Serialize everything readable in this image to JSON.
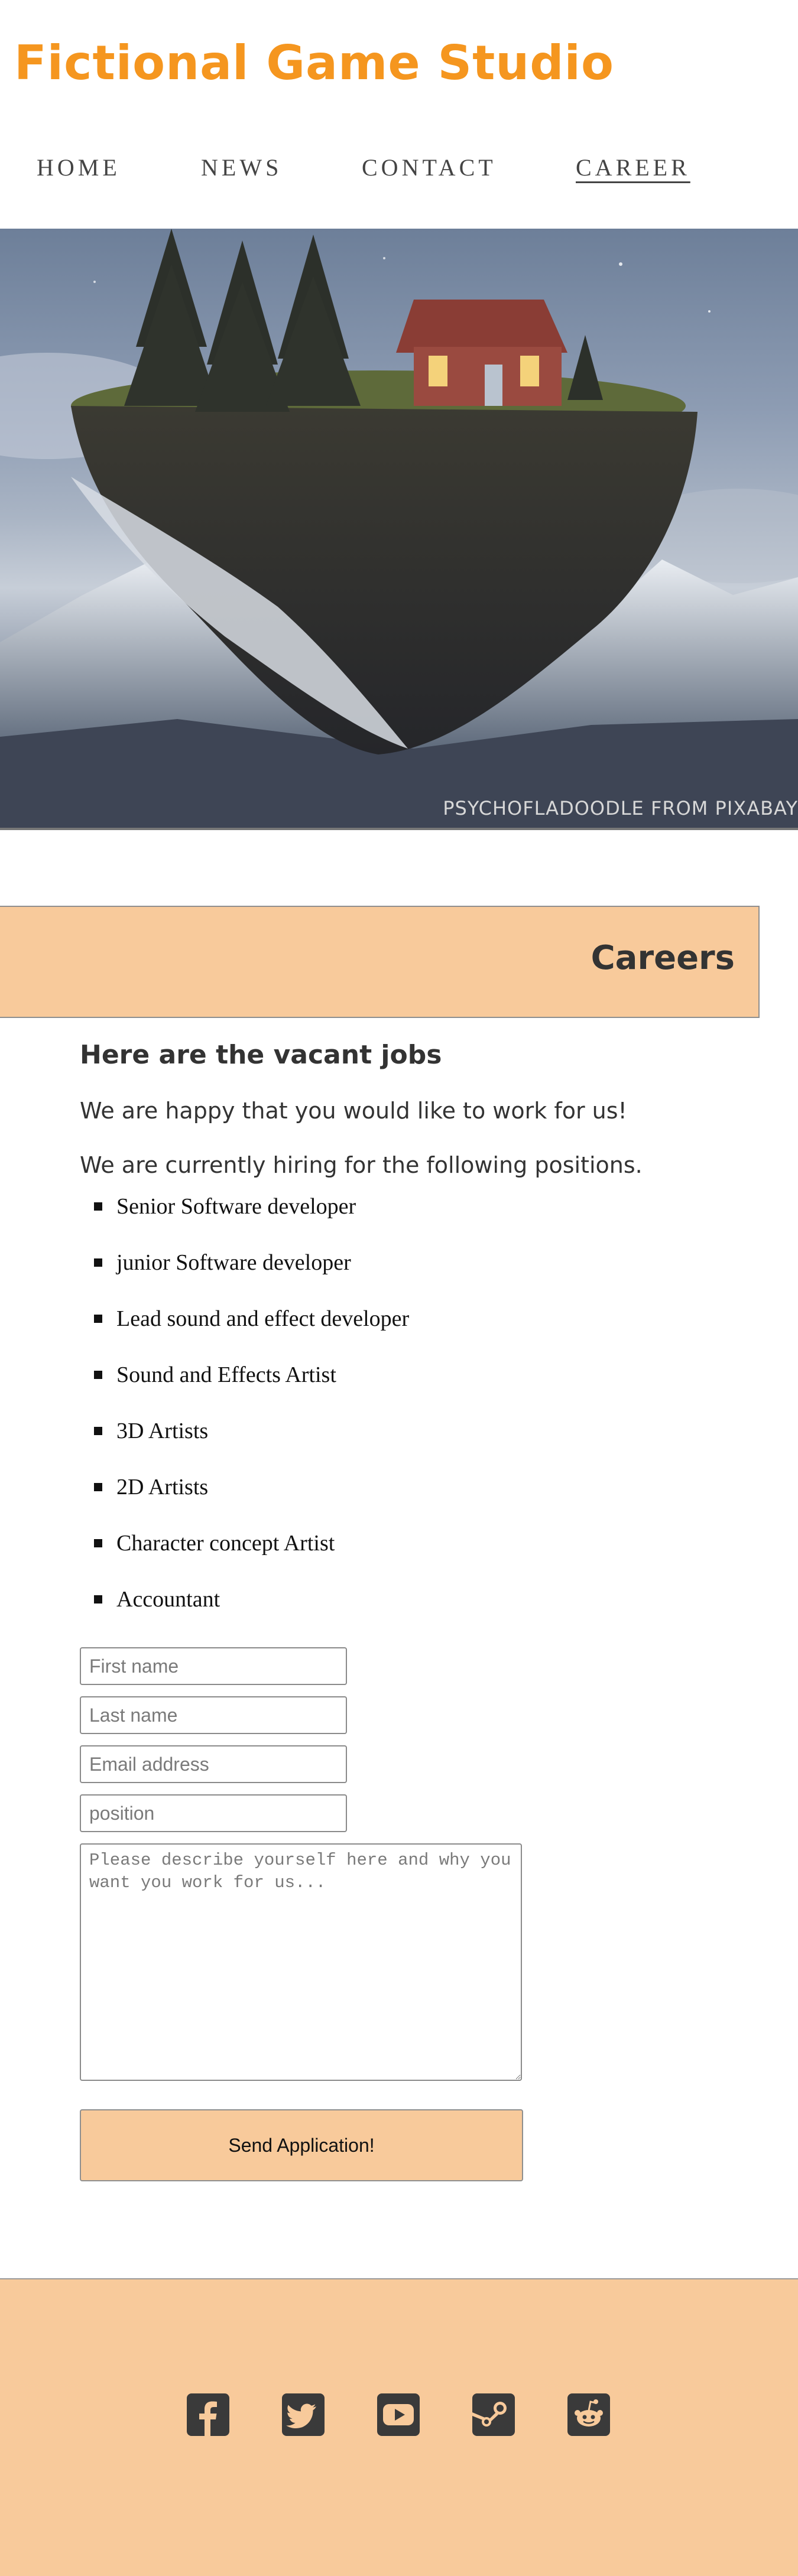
{
  "header": {
    "title": "Fictional Game Studio"
  },
  "nav": {
    "items": [
      {
        "label": "HOME"
      },
      {
        "label": "NEWS"
      },
      {
        "label": "CONTACT"
      },
      {
        "label": "CAREER",
        "active": true
      }
    ]
  },
  "hero": {
    "credit": "PSYCHOFLADOODLE FROM PIXABAY"
  },
  "careers": {
    "heading": "Careers",
    "vacancy_title": "Here are the vacant jobs",
    "intro_1": "We are happy that you would like to work for us!",
    "intro_2": "We are currently hiring for the following positions.",
    "jobs": [
      "Senior Software developer",
      "junior Software developer",
      "Lead sound and effect developer",
      "Sound and Effects Artist",
      "3D Artists",
      "2D Artists",
      "Character concept Artist",
      "Accountant"
    ]
  },
  "form": {
    "first_name_placeholder": "First name",
    "last_name_placeholder": "Last name",
    "email_placeholder": "Email address",
    "position_placeholder": "position",
    "about_placeholder": "Please describe yourself here and why you want you work for us...",
    "submit_label": "Send Application!"
  },
  "footer": {
    "social_icons": [
      "facebook-icon",
      "twitter-icon",
      "youtube-icon",
      "steam-icon",
      "reddit-icon"
    ]
  },
  "colors": {
    "brand_orange": "#f5961f",
    "peach": "#f8ca9b",
    "icon_dark": "#3a3a3a"
  }
}
